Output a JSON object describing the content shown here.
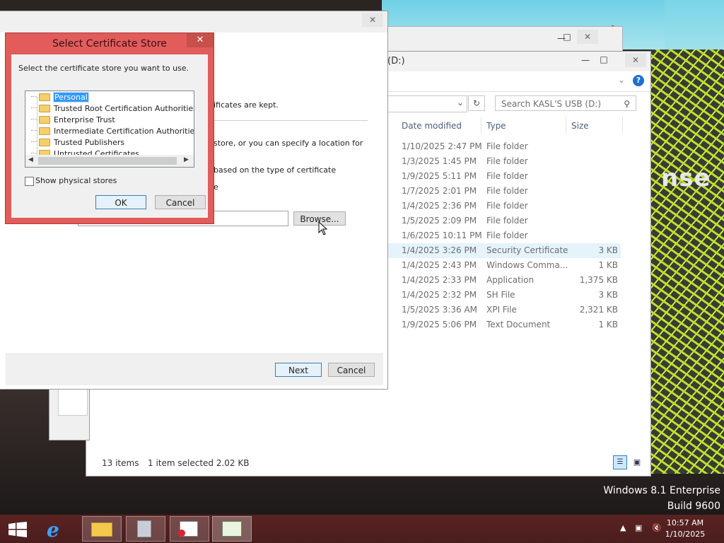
{
  "watermark": {
    "edition": "Windows 8.1 Enterprise",
    "build": "Build 9600"
  },
  "wallpaper": {
    "text": "nse"
  },
  "explorer": {
    "title_fragment": "(D:)",
    "search_placeholder": "Search KASL'S USB (D:)",
    "columns": {
      "date": "Date modified",
      "type": "Type",
      "size": "Size"
    },
    "rows": [
      {
        "date": "1/10/2025 2:47 PM",
        "type": "File folder",
        "size": ""
      },
      {
        "date": "1/3/2025 1:45 PM",
        "type": "File folder",
        "size": ""
      },
      {
        "date": "1/9/2025 5:11 PM",
        "type": "File folder",
        "size": ""
      },
      {
        "date": "1/7/2025 2:01 PM",
        "type": "File folder",
        "size": ""
      },
      {
        "date": "1/4/2025 2:36 PM",
        "type": "File folder",
        "size": ""
      },
      {
        "date": "1/5/2025 2:09 PM",
        "type": "File folder",
        "size": ""
      },
      {
        "date": "1/6/2025 10:11 PM",
        "type": "File folder",
        "size": ""
      },
      {
        "date": "1/4/2025 3:26 PM",
        "type": "Security Certificate",
        "size": "3 KB",
        "selected": true
      },
      {
        "date": "1/4/2025 2:43 PM",
        "type": "Windows Comma...",
        "size": "1 KB"
      },
      {
        "date": "1/4/2025 2:33 PM",
        "type": "Application",
        "size": "1,375 KB"
      },
      {
        "date": "1/4/2025 2:32 PM",
        "type": "SH File",
        "size": "3 KB"
      },
      {
        "date": "1/5/2025 3:36 AM",
        "type": "XPI File",
        "size": "2,321 KB"
      },
      {
        "date": "1/9/2025 5:06 PM",
        "type": "Text Document",
        "size": "1 KB"
      }
    ],
    "status": {
      "items": "13 items",
      "selected": "1 item selected  2.02 KB"
    }
  },
  "wizard": {
    "text1": "ificates are kept.",
    "text2": "store, or you can specify a location for",
    "text3": "based on the type of certificate",
    "text4": "e",
    "browse_label": "Browse...",
    "next_label": "Next",
    "cancel_label": "Cancel"
  },
  "dialog": {
    "title": "Select Certificate Store",
    "instruction": "Select the certificate store you want to use.",
    "stores": [
      "Personal",
      "Trusted Root Certification Authorities",
      "Enterprise Trust",
      "Intermediate Certification Authorities",
      "Trusted Publishers",
      "Untrusted Certificates"
    ],
    "selected_store": "Personal",
    "show_physical_label": "Show physical stores",
    "show_physical_checked": false,
    "ok_label": "OK",
    "cancel_label": "Cancel"
  },
  "taskbar": {
    "time": "10:57 AM",
    "date": "1/10/2025",
    "apps": [
      "start-icon",
      "internet-explorer-icon",
      "file-explorer-icon",
      "server-manager-icon",
      "certificate-icon",
      "certificate-import-icon"
    ]
  },
  "colors": {
    "dialog_frame": "#e35c5c",
    "taskbar": "#5b2323",
    "accent": "#3399ff"
  }
}
